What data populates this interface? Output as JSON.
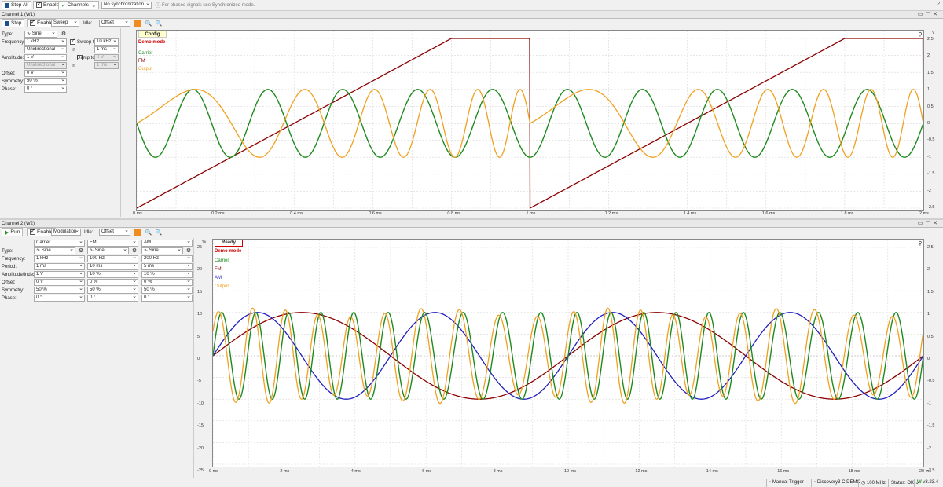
{
  "toolbar": {
    "stop_all": "Stop All",
    "enable": "Enable",
    "channels": "Channels",
    "sync": "No synchronization",
    "hint": "For phased signals use Synchronized mode."
  },
  "ch1": {
    "title": "Channel 1 (W1)",
    "run_btn": "Stop",
    "enable": "Enable",
    "mode": "Sweep",
    "idle_label": "Idle:",
    "idle": "Offset",
    "params": {
      "type_label": "Type:",
      "type": "Sine",
      "freq_label": "Frequency:",
      "freq": "1 kHz",
      "sweep_label": "Sweep to",
      "sweep_to": "10 kHz",
      "direction": "Unidirectional",
      "in1": "in",
      "in1_val": "1 ms",
      "amp_label": "Amplitude:",
      "amp": "1 V",
      "damp_label": "Damp to",
      "damp_to": "0 V",
      "direction2": "Unidirectional",
      "in2": "in",
      "in2_val": "1 ms",
      "offset_label": "Offset:",
      "offset": "0 V",
      "sym_label": "Symmetry:",
      "sym": "50 %",
      "phase_label": "Phase:",
      "phase": "0 °"
    },
    "overlay": {
      "config": "Config",
      "demo": "Demo mode",
      "carrier": "Carrier",
      "fm": "FM",
      "output": "Output"
    },
    "y_unit": "V",
    "y_ticks": [
      "2.5",
      "2",
      "1.5",
      "1",
      "0.5",
      "0",
      "-0.5",
      "-1",
      "-1.5",
      "-2",
      "-2.5"
    ],
    "x_ticks": [
      "0 ms",
      "0.2 ms",
      "0.4 ms",
      "0.6 ms",
      "0.8 ms",
      "1 ms",
      "1.2 ms",
      "1.4 ms",
      "1.6 ms",
      "1.8 ms",
      "2 ms"
    ]
  },
  "ch2": {
    "title": "Channel 2 (W2)",
    "run_btn": "Run",
    "enable": "Enable",
    "mode": "Modulation",
    "idle_label": "Idle:",
    "idle": "Offset",
    "col_headers": [
      "Carrier",
      "FM",
      "AM"
    ],
    "rows": [
      {
        "label": "Type:",
        "vals": [
          "Sine",
          "Sine",
          "Sine"
        ]
      },
      {
        "label": "Frequency:",
        "vals": [
          "1 kHz",
          "100 Hz",
          "200 Hz"
        ]
      },
      {
        "label": "Period:",
        "vals": [
          "1 ms",
          "10 ms",
          "5 ms"
        ]
      },
      {
        "label": "Amplitude/Index:",
        "vals": [
          "1 V",
          "10 %",
          "10 %"
        ]
      },
      {
        "label": "Offset:",
        "vals": [
          "0 V",
          "0 %",
          "0 %"
        ]
      },
      {
        "label": "Symmetry:",
        "vals": [
          "50 %",
          "50 %",
          "50 %"
        ]
      },
      {
        "label": "Phase:",
        "vals": [
          "0 °",
          "0 °",
          "0 °"
        ]
      }
    ],
    "overlay": {
      "ready": "Ready",
      "demo": "Demo mode",
      "carrier": "Carrier",
      "fm": "FM",
      "am": "AM",
      "output": "Output"
    },
    "y_unit_left": "%",
    "y_ticks_left": [
      "25",
      "20",
      "15",
      "10",
      "5",
      "0",
      "-5",
      "-10",
      "-15",
      "-20",
      "-25"
    ],
    "y_ticks_right": [
      "2.5",
      "2",
      "1.5",
      "1",
      "0.5",
      "0",
      "-0.5",
      "-1",
      "-1.5",
      "-2",
      "-2.5"
    ],
    "x_ticks": [
      "0 ms",
      "2 ms",
      "4 ms",
      "6 ms",
      "8 ms",
      "10 ms",
      "12 ms",
      "14 ms",
      "16 ms",
      "18 ms",
      "20 ms"
    ]
  },
  "statusbar": {
    "trigger": "Manual Trigger",
    "device": "Discovery3 C DEMO",
    "clock": "100 MHz",
    "status": "Status: OK",
    "version": "v3.23.4"
  },
  "colors": {
    "carrier": "#1e8a1e",
    "fm": "#8b0000",
    "am": "#2020c0",
    "output": "#f0a020",
    "accent": "#f08c1e"
  }
}
